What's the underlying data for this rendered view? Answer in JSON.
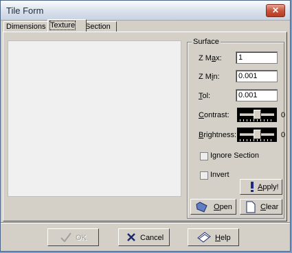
{
  "window": {
    "title": "Tile Form",
    "close_label": "✕"
  },
  "tabs": [
    {
      "label": "Dimensions"
    },
    {
      "label": "Texture"
    },
    {
      "label": "Section"
    }
  ],
  "surface": {
    "group_label": "Surface",
    "zmax": {
      "pre": "Z M",
      "key": "a",
      "post": "x:",
      "value": "1"
    },
    "zmin": {
      "pre": "Z M",
      "key": "i",
      "post": "n:",
      "value": "0.001"
    },
    "tol": {
      "key": "T",
      "post": "ol:",
      "value": "0.001"
    },
    "contrast": {
      "key": "C",
      "post": "ontrast:",
      "value": "0",
      "level": 0.5
    },
    "brightness": {
      "key": "B",
      "post": "rightness:",
      "value": "0",
      "level": 0.5
    },
    "ignore_section": {
      "label": "Ignore Section",
      "checked": false
    },
    "invert": {
      "label": "Invert",
      "checked": false
    },
    "apply": {
      "key": "A",
      "post": "pply!"
    },
    "open": {
      "key": "O",
      "post": "pen"
    },
    "clear": {
      "key": "C",
      "post": "lear"
    }
  },
  "footer": {
    "ok": {
      "label": "OK",
      "enabled": false
    },
    "cancel": {
      "label": "Cancel"
    },
    "help": {
      "key": "H",
      "post": "elp"
    }
  }
}
